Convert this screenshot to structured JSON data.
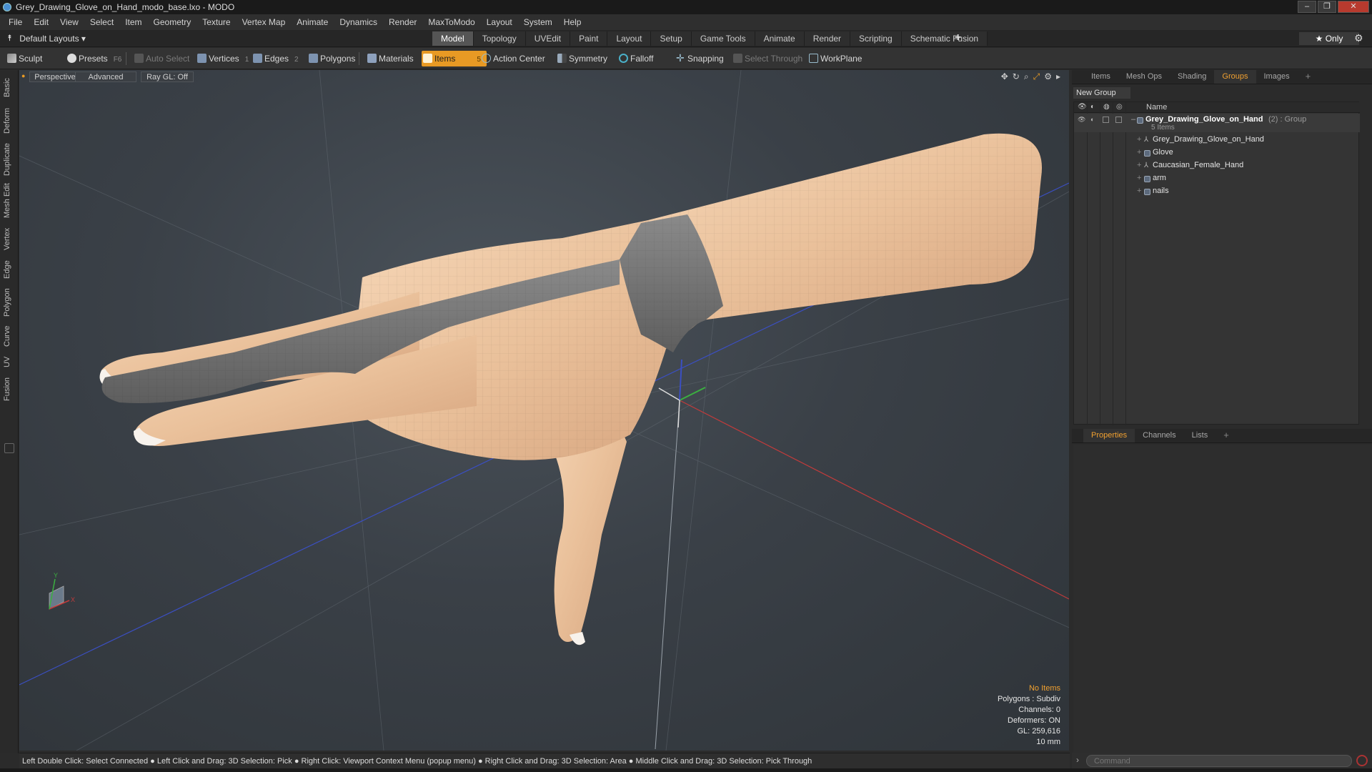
{
  "window": {
    "title": "Grey_Drawing_Glove_on_Hand_modo_base.lxo - MODO",
    "buttons": [
      "–",
      "❐",
      "✕"
    ]
  },
  "menu": [
    "File",
    "Edit",
    "View",
    "Select",
    "Item",
    "Geometry",
    "Texture",
    "Vertex Map",
    "Animate",
    "Dynamics",
    "Render",
    "MaxToModo",
    "Layout",
    "System",
    "Help"
  ],
  "layoutbar": {
    "layout_name": "Default Layouts ▾",
    "tabs": [
      "Model",
      "Topology",
      "UVEdit",
      "Paint",
      "Layout",
      "Setup",
      "Game Tools",
      "Animate",
      "Render",
      "Scripting",
      "Schematic Fusion"
    ],
    "active_tab": "Model",
    "plus": "+",
    "only": "★ Only"
  },
  "toolbar": {
    "sculpt": "Sculpt",
    "presets": "Presets",
    "presets_key": "F6",
    "auto_select": "Auto Select",
    "vertices": "Vertices",
    "vertices_key": "1",
    "edges": "Edges",
    "edges_key": "2",
    "polygons": "Polygons",
    "materials": "Materials",
    "items": "Items",
    "items_key": "5",
    "action_center": "Action Center",
    "symmetry": "Symmetry",
    "falloff": "Falloff",
    "snapping": "Snapping",
    "select_through": "Select Through",
    "workplane": "WorkPlane"
  },
  "left_tabs": [
    "Basic",
    "Deform",
    "Duplicate",
    "Mesh Edit",
    "Vertex",
    "Edge",
    "Polygon",
    "Curve",
    "UV",
    "Fusion"
  ],
  "viewport": {
    "view": "Perspective",
    "shading": "Advanced",
    "raygl": "Ray GL: Off",
    "hud": {
      "selection": "No Items",
      "polygons": "Polygons : Subdiv",
      "channels": "Channels: 0",
      "deformers": "Deformers: ON",
      "gl": "GL: 259,616",
      "scale": "10 mm"
    },
    "axis_labels": {
      "y": "Y",
      "x": "X"
    }
  },
  "right_top_tabs": [
    "Items",
    "Mesh Ops",
    "Shading",
    "Groups",
    "Images",
    "+"
  ],
  "right_top_active": "Groups",
  "groups": {
    "new_group": "New Group",
    "col_name": "Name",
    "root": {
      "name": "Grey_Drawing_Glove_on_Hand",
      "suffix": "(2) : Group",
      "count": "5 Items"
    },
    "children": [
      "Grey_Drawing_Glove_on_Hand",
      "Glove",
      "Caucasian_Female_Hand",
      "arm",
      "nails"
    ]
  },
  "right_bottom_tabs": [
    "Properties",
    "Channels",
    "Lists",
    "+"
  ],
  "right_bottom_active": "Properties",
  "statusbar": "Left Double Click: Select Connected ● Left Click and Drag: 3D Selection: Pick ● Right Click: Viewport Context Menu (popup menu) ● Right Click and Drag: 3D Selection: Area ● Middle Click and Drag: 3D Selection: Pick Through",
  "command": {
    "placeholder": "Command"
  },
  "colors": {
    "accent": "#e89a24",
    "skin": "#e8c29e",
    "glove": "#7d7d7d",
    "x_axis": "#c23b3b",
    "z_axis": "#3b4fc2",
    "y_axis": "#3bb040"
  }
}
